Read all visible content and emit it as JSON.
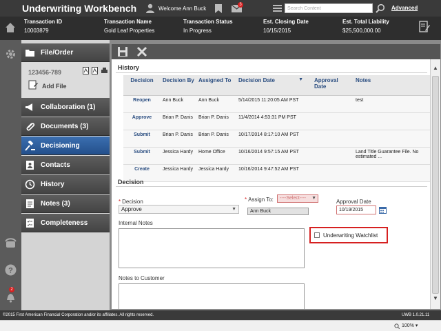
{
  "app": {
    "title": "Underwriting Workbench",
    "welcome": "Welcome Ann Buck",
    "mail_count": "3",
    "search_placeholder": "Search Content",
    "advanced_label": "Advanced"
  },
  "transaction": {
    "columns": [
      {
        "label": "Transaction ID",
        "value": "10003879"
      },
      {
        "label": "Transaction Name",
        "value": "Gold Leaf Properties"
      },
      {
        "label": "Transaction Status",
        "value": "In Progress"
      },
      {
        "label": "Est. Closing Date",
        "value": "10/15/2015"
      },
      {
        "label": "Est. Total Liability",
        "value": "$25,500,000.00"
      }
    ]
  },
  "rail": {
    "bell_count": "2"
  },
  "sidebar": {
    "file_order_label": "File/Order",
    "file_number": "123456-789",
    "add_file_label": "Add File",
    "items": [
      {
        "label": "Collaboration (1)",
        "icon": "megaphone-icon"
      },
      {
        "label": "Documents (3)",
        "icon": "paperclip-icon"
      },
      {
        "label": "Decisioning",
        "icon": "gavel-icon",
        "active": true
      },
      {
        "label": "Contacts",
        "icon": "contacts-icon"
      },
      {
        "label": "History",
        "icon": "clock-icon"
      },
      {
        "label": "Notes (3)",
        "icon": "notes-icon"
      },
      {
        "label": "Completeness",
        "icon": "checklist-icon"
      }
    ]
  },
  "history": {
    "section_title": "History",
    "headers": [
      "Decision",
      "Decision By",
      "Assigned To",
      "Decision Date",
      "Approval Date",
      "Notes"
    ],
    "rows": [
      [
        "Reopen",
        "Ann Buck",
        "Ann Buck",
        "5/14/2015 11:20:05 AM PST",
        "",
        "test"
      ],
      [
        "Approve",
        "Brian P. Danis",
        "Brian P. Danis",
        "11/4/2014 4:53:31 PM PST",
        "",
        ""
      ],
      [
        "Submit",
        "Brian P. Danis",
        "Brian P. Danis",
        "10/17/2014 8:17:10 AM PST",
        "",
        ""
      ],
      [
        "Submit",
        "Jessica Hardy",
        "Home Office",
        "10/16/2014 9:57:15 AM PST",
        "",
        "Land Title Guarantee File. No estimated ..."
      ],
      [
        "Create",
        "Jessica Hardy",
        "Jessica Hardy",
        "10/16/2014 9:47:52 AM PST",
        "",
        ""
      ]
    ]
  },
  "decision": {
    "section_title": "Decision",
    "decision_label": "Decision",
    "decision_value": "Approve",
    "assign_label": "Assign To:",
    "assign_select": "----Select----",
    "assign_value": "Ann Buck",
    "approval_date_label": "Approval Date",
    "approval_date_value": "10/19/2015",
    "internal_notes_label": "Internal Notes",
    "watchlist_label": "Underwriting Watchlist",
    "notes_to_customer_label": "Notes to Customer"
  },
  "footer": {
    "copyright": "©2015 First American Financial Corporation and/or its affiliates. All rights reserved.",
    "version": "UWB 1.0.21.11"
  },
  "status": {
    "zoom": "100%"
  }
}
